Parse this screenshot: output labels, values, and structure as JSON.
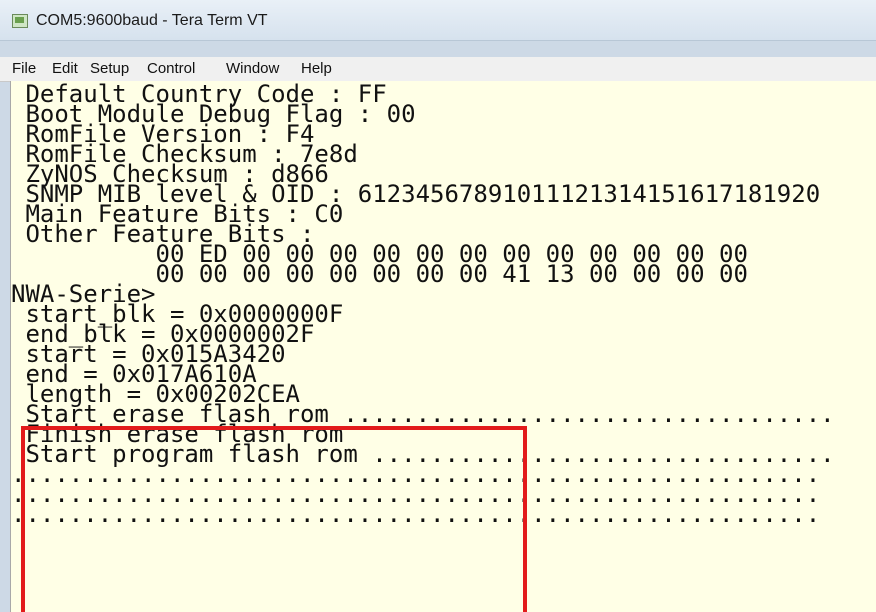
{
  "window": {
    "title": "COM5:9600baud - Tera Term VT"
  },
  "menu": {
    "items": [
      "File",
      "Edit",
      "Setup",
      "Control",
      "Window",
      "Help"
    ]
  },
  "terminal": {
    "lines": [
      " Default Country Code : FF",
      " Boot Module Debug Flag : 00",
      " RomFile Version : F4",
      " RomFile Checksum : 7e8d",
      " ZyNOS Checksum : d866",
      " SNMP MIB level & OID : 61234567891011121314151617181920",
      " Main Feature Bits : C0",
      " Other Feature Bits :",
      "          00 ED 00 00 00 00 00 00 00 00 00 00 00 00",
      "          00 00 00 00 00 00 00 00 41 13 00 00 00 00",
      "NWA-Serie>",
      " start_blk = 0x0000000F",
      " end_blk = 0x0000002F",
      " start = 0x015A3420",
      " end = 0x017A610A",
      " length = 0x00202CEA",
      " Start erase flash rom ..................................",
      " Finish erase flash rom",
      " Start program flash rom ................................",
      "........................................................",
      "........................................................",
      "........................................................"
    ]
  },
  "annotation": {
    "highlight_color": "#e21b1b"
  }
}
